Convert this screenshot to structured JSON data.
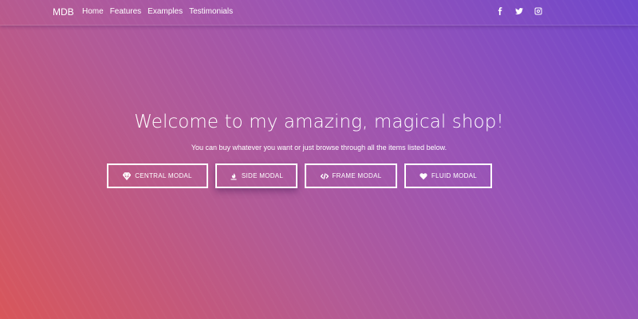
{
  "navbar": {
    "brand": "MDB",
    "links": [
      "Home",
      "Features",
      "Examples",
      "Testimonials"
    ],
    "social": [
      "facebook-icon",
      "twitter-icon",
      "instagram-icon"
    ]
  },
  "hero": {
    "title": "Welcome to my amazing, magical shop!",
    "subtitle": "You can buy whatever you want or just browse through all the items listed below."
  },
  "buttons": [
    {
      "label": "CENTRAL MODAL",
      "icon": "diamond-icon"
    },
    {
      "label": "SIDE MODAL",
      "icon": "fire-icon"
    },
    {
      "label": "FRAME MODAL",
      "icon": "code-icon"
    },
    {
      "label": "FLUID MODAL",
      "icon": "heart-icon"
    }
  ],
  "colors": {
    "gradient_start": "#d8565a",
    "gradient_mid": "#9a54b6",
    "gradient_end": "#6f47cc",
    "text": "#ffffff"
  }
}
